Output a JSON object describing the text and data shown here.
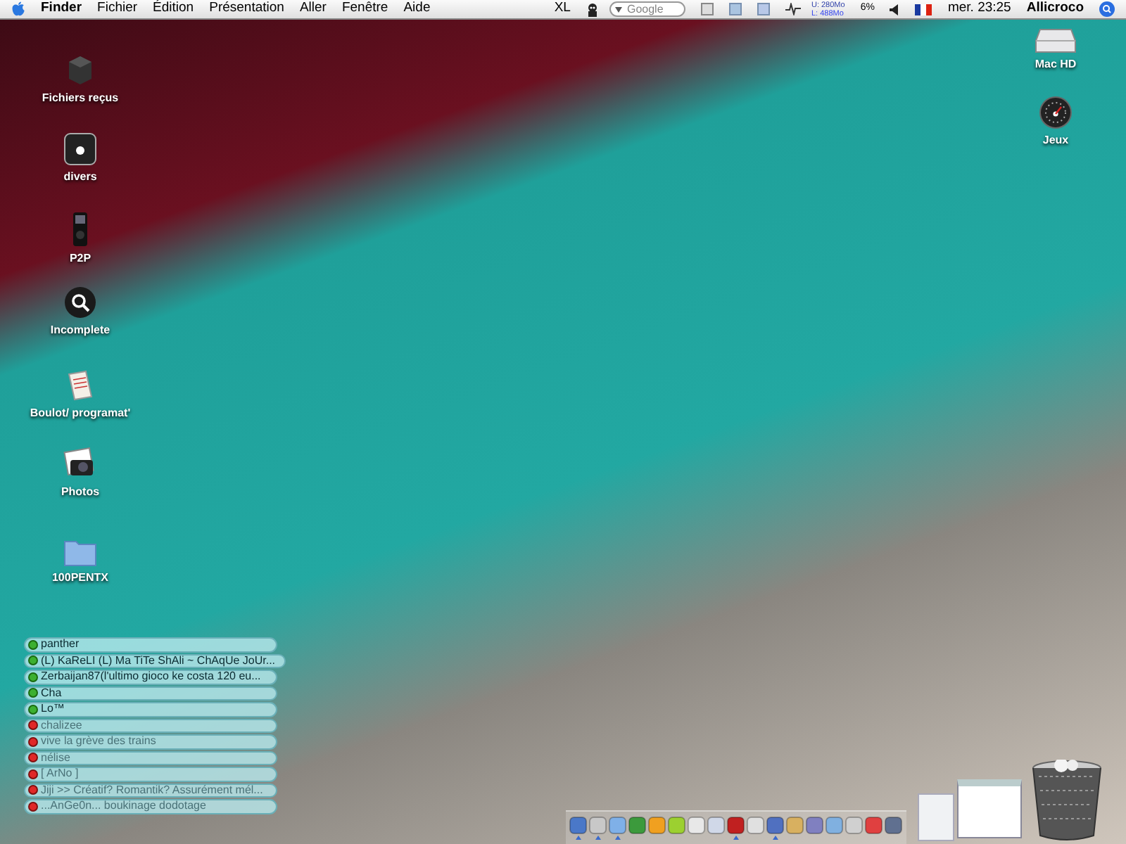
{
  "menu_bar": {
    "app": "Finder",
    "menus": [
      "Fichier",
      "Édition",
      "Présentation",
      "Aller",
      "Fenêtre",
      "Aide"
    ],
    "status_text": "XL",
    "search": {
      "placeholder": "Google"
    },
    "memory": {
      "used": "U: 280Mo",
      "free": "L: 488Mo"
    },
    "battery": "6%",
    "clock": "mer. 23:25",
    "user": "Allicroco"
  },
  "desktop_icons_left": [
    {
      "label": "Fichiers reçus",
      "kind": "box"
    },
    {
      "label": "divers",
      "kind": "apple"
    },
    {
      "label": "P2P",
      "kind": "player"
    },
    {
      "label": "Incomplete",
      "kind": "search"
    },
    {
      "label": "Boulot/ programat'",
      "kind": "document"
    },
    {
      "label": "Photos",
      "kind": "photos"
    },
    {
      "label": "100PENTX",
      "kind": "folder"
    }
  ],
  "desktop_icons_right": [
    {
      "label": "Mac HD",
      "kind": "drive"
    },
    {
      "label": "Jeux",
      "kind": "gauge"
    }
  ],
  "buddy_list": [
    {
      "name": "panther",
      "online": true
    },
    {
      "name": "(L) KaReLI (L) Ma TiTe ShAli ~ ChAqUe JoUr...",
      "online": true
    },
    {
      "name": "Zerbaijan87(l'ultimo gioco ke costa 120 eu...",
      "online": true
    },
    {
      "name": "Cha",
      "online": true
    },
    {
      "name": "Lo™",
      "online": true
    },
    {
      "name": "chalizee",
      "online": false
    },
    {
      "name": "vive la grève des trains",
      "online": false
    },
    {
      "name": "nélise",
      "online": false
    },
    {
      "name": "[ ArNo ]",
      "online": false
    },
    {
      "name": "Jiji >> Créatif? Romantik? Assurément mél...",
      "online": false
    },
    {
      "name": "...AnGe0n... boukinage dodotage",
      "online": false
    }
  ],
  "dock": {
    "apps": [
      {
        "running": true
      },
      {
        "running": true
      },
      {
        "running": true
      },
      {
        "running": false
      },
      {
        "running": false
      },
      {
        "running": false
      },
      {
        "running": false
      },
      {
        "running": false
      },
      {
        "running": true
      },
      {
        "running": false
      },
      {
        "running": true
      },
      {
        "running": false
      },
      {
        "running": false
      },
      {
        "running": false
      },
      {
        "running": false
      },
      {
        "running": false
      },
      {
        "running": false
      }
    ]
  }
}
